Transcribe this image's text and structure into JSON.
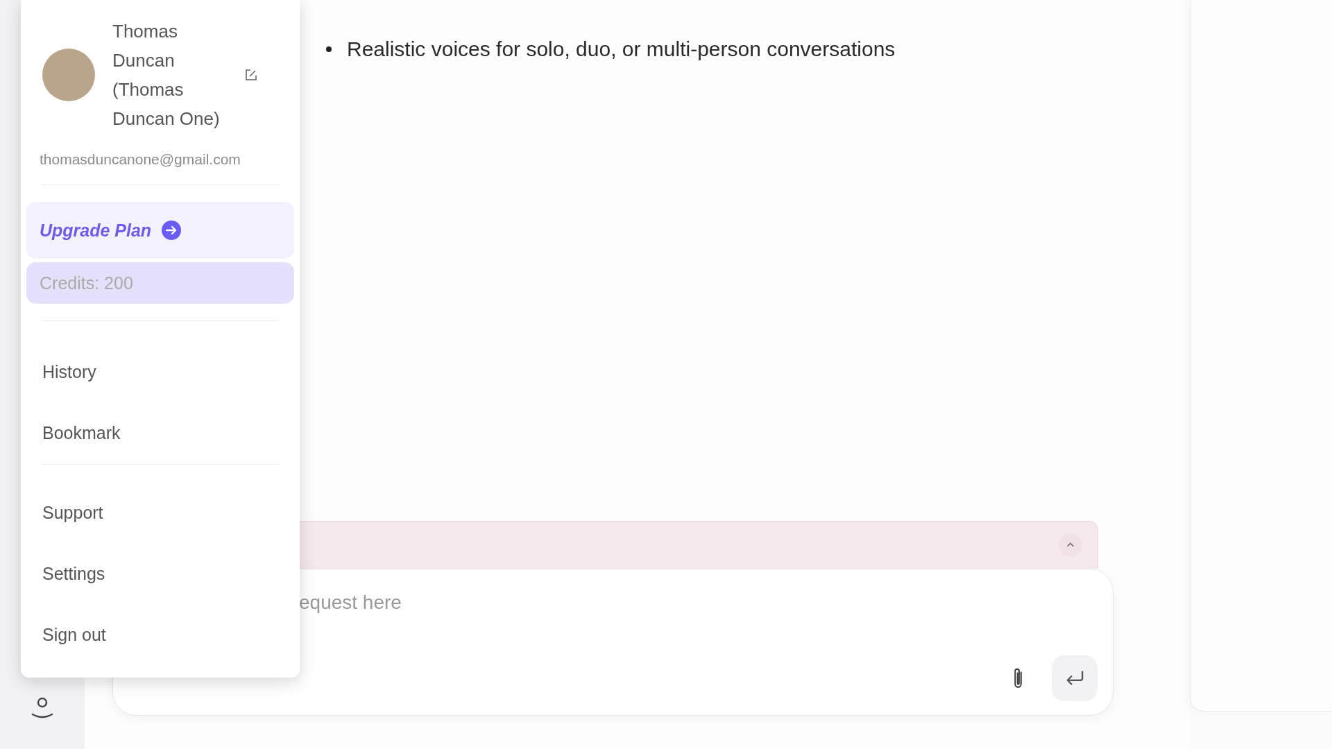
{
  "content": {
    "bullets": [
      "Realistic voices for solo, duo, or multi-person conversations"
    ]
  },
  "composer": {
    "placeholder": "equest here"
  },
  "account_menu": {
    "name": "Thomas Duncan (Thomas Duncan One)",
    "email": "thomasduncanone@gmail.com",
    "groups": [
      [
        {
          "kind": "upgrade",
          "label": "Upgrade Plan",
          "selected": false
        },
        {
          "kind": "plain",
          "label": "Credits: 200",
          "selected": true
        }
      ],
      [
        {
          "kind": "plain",
          "label": "History",
          "selected": false
        },
        {
          "kind": "plain",
          "label": "Bookmark",
          "selected": false
        }
      ],
      [
        {
          "kind": "plain",
          "label": "Support",
          "selected": false
        },
        {
          "kind": "plain",
          "label": "Settings",
          "selected": false
        },
        {
          "kind": "plain",
          "label": "Sign out",
          "selected": false
        }
      ]
    ]
  }
}
